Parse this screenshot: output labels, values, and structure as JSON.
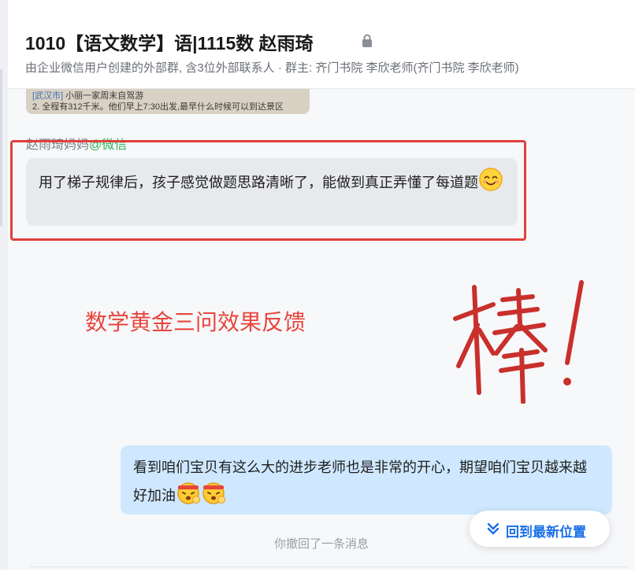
{
  "header": {
    "title": "1010【语文数学】语|1115数 赵雨琦",
    "subtitle": "由企业微信用户创建的外部群, 含3位外部联系人 · 群主: 齐门书院 李欣老师(齐门书院 李欣老师)"
  },
  "image_message": {
    "line1_tag": "[武汉市]",
    "line1_text": " 小丽一家周末自驾游",
    "line2": "2. 全程有312千米。他们早上7:30出发,最早什么时候可以到达景区"
  },
  "sender": {
    "name": "赵雨琦妈妈",
    "external_tag": "@微信"
  },
  "incoming_message": {
    "text": "用了梯子规律后，孩子感觉做题思路清晰了，能做到真正弄懂了每道题",
    "emoji": "smiling-face"
  },
  "caption": "数学黄金三问效果反馈",
  "handwritten": "棒!",
  "outgoing_message": {
    "text": "看到咱们宝贝有这么大的进步老师也是非常的开心，期望咱们宝贝越来越好加油",
    "emojis": [
      "cheering-face",
      "cheering-face"
    ]
  },
  "latest_button": {
    "label": "回到最新位置",
    "icon": "double-chevron-down-icon",
    "color": "#1a6fe8"
  },
  "recall_notice": "你撤回了一条消息",
  "colors": {
    "highlight_border": "#e0403c",
    "caption": "#e8453c",
    "handwriting": "#c9302c",
    "incoming_bubble": "#e7e9ed",
    "outgoing_bubble": "#cfe8ff",
    "external_tag": "#2fb35a"
  }
}
